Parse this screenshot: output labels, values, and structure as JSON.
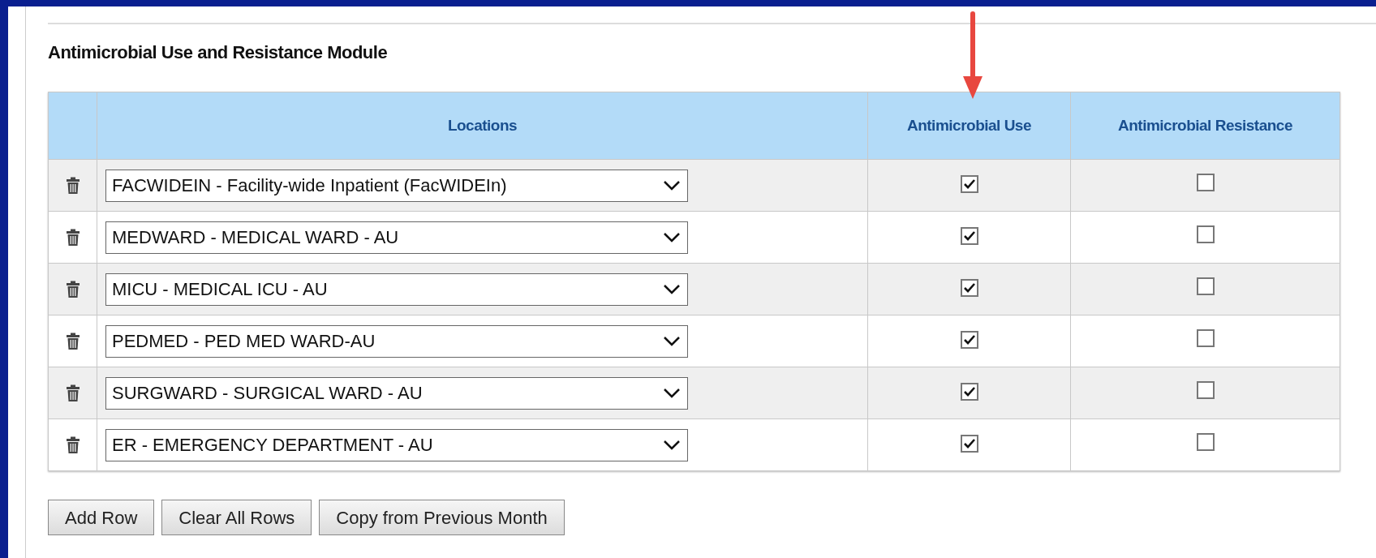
{
  "title": "Antimicrobial Use and Resistance Module",
  "table": {
    "columns": [
      "Locations",
      "Antimicrobial Use",
      "Antimicrobial Resistance"
    ],
    "rows": [
      {
        "location": "FACWIDEIN - Facility-wide Inpatient (FacWIDEIn)",
        "use": true,
        "resistance": false
      },
      {
        "location": "MEDWARD - MEDICAL WARD - AU",
        "use": true,
        "resistance": false
      },
      {
        "location": "MICU - MEDICAL ICU - AU",
        "use": true,
        "resistance": false
      },
      {
        "location": "PEDMED - PED MED WARD-AU",
        "use": true,
        "resistance": false
      },
      {
        "location": "SURGWARD - SURGICAL WARD - AU",
        "use": true,
        "resistance": false
      },
      {
        "location": "ER - EMERGENCY DEPARTMENT - AU",
        "use": true,
        "resistance": false
      }
    ]
  },
  "buttons": [
    "Add Row",
    "Clear All Rows",
    "Copy from Previous Month"
  ]
}
